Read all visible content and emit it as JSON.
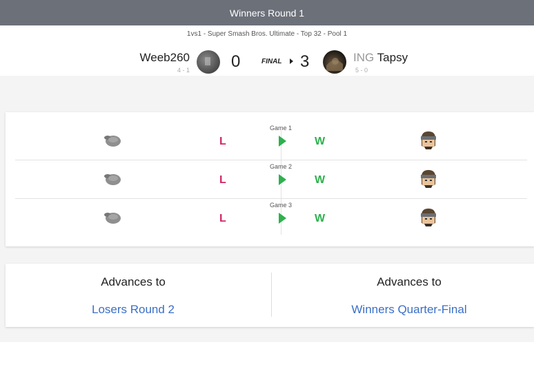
{
  "header": {
    "round_title": "Winners Round 1"
  },
  "set": {
    "subtitle": "1vs1 - Super Smash Bros. Ultimate - Top 32 - Pool 1",
    "status": "FINAL"
  },
  "player1": {
    "name": "Weeb260",
    "record": "4 - 1",
    "score": "0"
  },
  "player2": {
    "prefix": "ING",
    "name": "Tapsy",
    "record": "5 - 0",
    "score": "3"
  },
  "games": [
    {
      "label": "Game 1",
      "p1_result": "L",
      "p2_result": "W",
      "p1_character_icon": "pikmin-icon",
      "p2_character_icon": "snake-icon"
    },
    {
      "label": "Game 2",
      "p1_result": "L",
      "p2_result": "W",
      "p1_character_icon": "pikmin-icon",
      "p2_character_icon": "snake-icon"
    },
    {
      "label": "Game 3",
      "p1_result": "L",
      "p2_result": "W",
      "p1_character_icon": "pikmin-icon",
      "p2_character_icon": "snake-icon"
    }
  ],
  "advances": {
    "left": {
      "heading": "Advances to",
      "target": "Losers Round 2"
    },
    "right": {
      "heading": "Advances to",
      "target": "Winners Quarter-Final"
    }
  },
  "colors": {
    "loss": "#d22566",
    "win": "#2db14d",
    "link": "#3a6fc7",
    "topbar": "#6c7079"
  }
}
